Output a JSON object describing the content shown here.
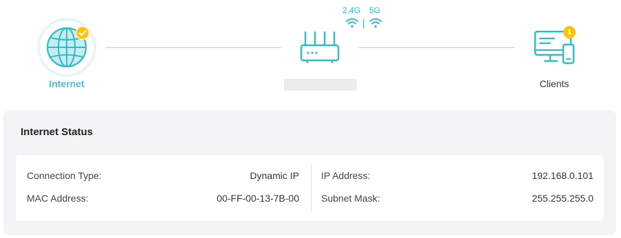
{
  "topology": {
    "internet": {
      "label": "Internet",
      "icon": "globe-icon",
      "status": "connected"
    },
    "router": {
      "icon": "router-icon",
      "bands": [
        "2.4G",
        "5G"
      ]
    },
    "clients": {
      "label": "Clients",
      "icon": "monitor-phone-icon",
      "count": "1"
    }
  },
  "internet_status": {
    "title": "Internet Status",
    "connection_type_label": "Connection Type:",
    "connection_type_value": "Dynamic IP",
    "mac_address_label": "MAC Address:",
    "mac_address_value": "00-FF-00-13-7B-00",
    "ip_address_label": "IP Address:",
    "ip_address_value": "192.168.0.101",
    "subnet_mask_label": "Subnet Mask:",
    "subnet_mask_value": "255.255.255.0"
  },
  "colors": {
    "accent": "#2dbbc6",
    "internet_label": "#4ac1cc",
    "badge": "#ffc400",
    "panel_bg": "#f3f4f6",
    "line": "#c8c8c8"
  }
}
